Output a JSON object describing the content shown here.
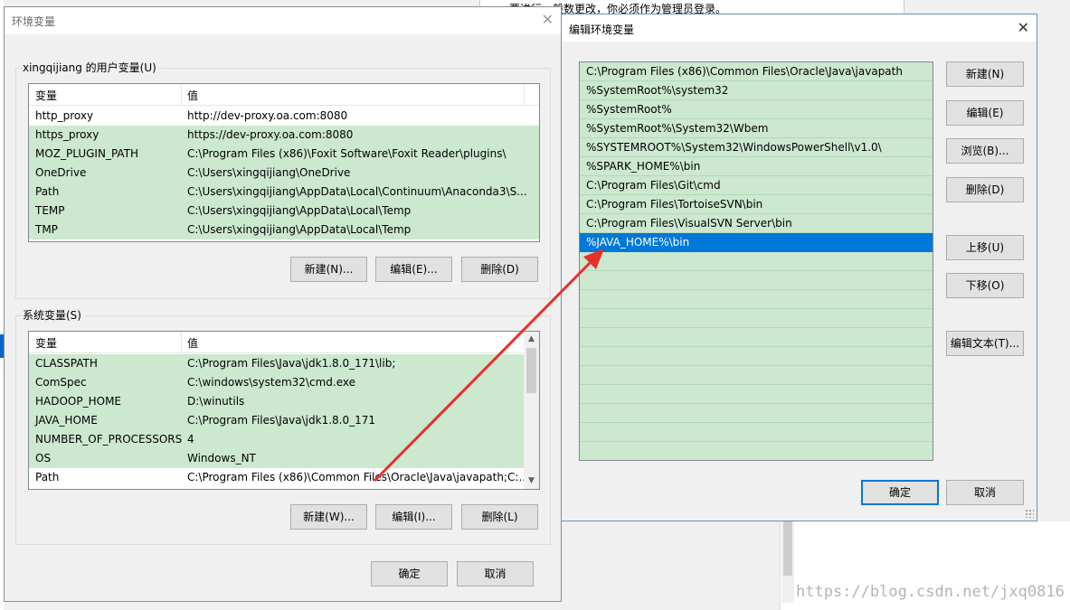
{
  "background": {
    "top_text": "要进行一般数更改，你必须作为管理员登录。",
    "watermark": "https://blog.csdn.net/jxq0816"
  },
  "env_dialog": {
    "title": "环境变量",
    "user_group_label": "xingqijiang 的用户变量(U)",
    "user_columns": [
      "变量",
      "值"
    ],
    "user_vars": [
      {
        "name": "http_proxy",
        "value": "http://dev-proxy.oa.com:8080"
      },
      {
        "name": "https_proxy",
        "value": "https://dev-proxy.oa.com:8080"
      },
      {
        "name": "MOZ_PLUGIN_PATH",
        "value": "C:\\Program Files (x86)\\Foxit Software\\Foxit Reader\\plugins\\"
      },
      {
        "name": "OneDrive",
        "value": "C:\\Users\\xingqijiang\\OneDrive"
      },
      {
        "name": "Path",
        "value": "C:\\Users\\xingqijiang\\AppData\\Local\\Continuum\\Anaconda3\\S..."
      },
      {
        "name": "TEMP",
        "value": "C:\\Users\\xingqijiang\\AppData\\Local\\Temp"
      },
      {
        "name": "TMP",
        "value": "C:\\Users\\xingqijiang\\AppData\\Local\\Temp"
      }
    ],
    "user_buttons": {
      "new": "新建(N)...",
      "edit": "编辑(E)...",
      "delete": "删除(D)"
    },
    "system_group_label": "系统变量(S)",
    "system_columns": [
      "变量",
      "值"
    ],
    "system_vars": [
      {
        "name": "CLASSPATH",
        "value": "C:\\Program Files\\Java\\jdk1.8.0_171\\lib;"
      },
      {
        "name": "ComSpec",
        "value": "C:\\windows\\system32\\cmd.exe"
      },
      {
        "name": "HADOOP_HOME",
        "value": "D:\\winutils"
      },
      {
        "name": "JAVA_HOME",
        "value": "C:\\Program Files\\Java\\jdk1.8.0_171"
      },
      {
        "name": "NUMBER_OF_PROCESSORS",
        "value": "4"
      },
      {
        "name": "OS",
        "value": "Windows_NT"
      },
      {
        "name": "Path",
        "value": "C:\\Program Files (x86)\\Common Files\\Oracle\\Java\\javapath;C:..."
      }
    ],
    "system_buttons": {
      "new": "新建(W)...",
      "edit": "编辑(I)...",
      "delete": "删除(L)"
    },
    "ok": "确定",
    "cancel": "取消"
  },
  "edit_dialog": {
    "title": "编辑环境变量",
    "paths": [
      "C:\\Program Files (x86)\\Common Files\\Oracle\\Java\\javapath",
      "%SystemRoot%\\system32",
      "%SystemRoot%",
      "%SystemRoot%\\System32\\Wbem",
      "%SYSTEMROOT%\\System32\\WindowsPowerShell\\v1.0\\",
      "%SPARK_HOME%\\bin",
      "C:\\Program Files\\Git\\cmd",
      "C:\\Program Files\\TortoiseSVN\\bin",
      "C:\\Program Files\\VisualSVN Server\\bin",
      "%JAVA_HOME%\\bin"
    ],
    "selected_index": 9,
    "buttons": {
      "new": "新建(N)",
      "edit": "编辑(E)",
      "browse": "浏览(B)...",
      "delete": "删除(D)",
      "up": "上移(U)",
      "down": "下移(O)",
      "edit_text": "编辑文本(T)..."
    },
    "ok": "确定",
    "cancel": "取消"
  },
  "colors": {
    "row_green": "#cce8cf",
    "selection": "#0078d7",
    "arrow": "#e8302a"
  }
}
